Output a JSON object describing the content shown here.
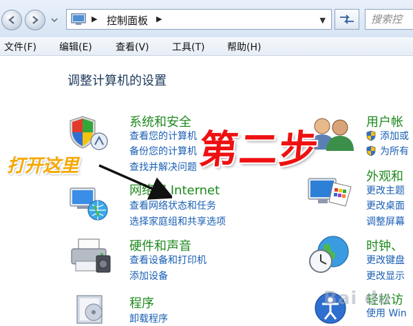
{
  "address_bar": {
    "path": "控制面板",
    "search_placeholder": "搜索控"
  },
  "menu": {
    "items": [
      "文件(F)",
      "编辑(E)",
      "查看(V)",
      "工具(T)",
      "帮助(H)"
    ]
  },
  "main": {
    "title": "调整计算机的设置",
    "left_categories": [
      {
        "title": "系统和安全",
        "links": [
          "查看您的计算机",
          "备份您的计算机",
          "查找并解决问题"
        ]
      },
      {
        "title": "网络和 Internet",
        "links": [
          "查看网络状态和任务",
          "选择家庭组和共享选项"
        ]
      },
      {
        "title": "硬件和声音",
        "links": [
          "查看设备和打印机",
          "添加设备"
        ]
      },
      {
        "title": "程序",
        "links": [
          "卸载程序"
        ]
      }
    ],
    "right_categories": [
      {
        "title": "用户帐",
        "links": [
          "添加或",
          "为所有"
        ]
      },
      {
        "title": "外观和",
        "links": [
          "更改主题",
          "更改桌面",
          "调整屏幕"
        ]
      },
      {
        "title": "时钟、",
        "links": [
          "更改键盘",
          "更改显示"
        ]
      },
      {
        "title": "轻松访",
        "links": [
          "使用 Win"
        ]
      }
    ]
  },
  "overlay": {
    "step": "第二步",
    "open_here": "打开这里",
    "watermark": "Bai du"
  },
  "colors": {
    "category_green": "#1e8a1e",
    "link_blue": "#1a5fb4",
    "title_navy": "#1e395b",
    "step_red": "#ee1111",
    "open_orange": "#f6a800"
  }
}
